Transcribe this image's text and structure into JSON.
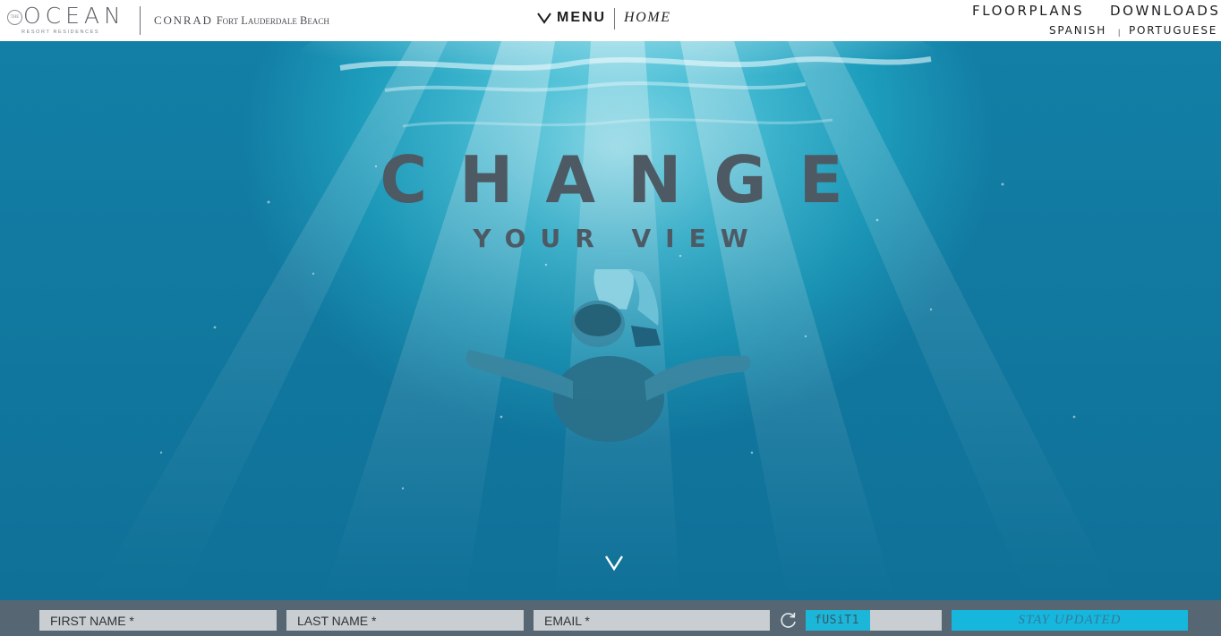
{
  "header": {
    "logo": {
      "small_mark": "THE",
      "word": "OCEAN",
      "tagline": "RESORT RESIDENCES"
    },
    "partner": {
      "brand": "CONRAD",
      "location": "Fort Lauderdale Beach"
    },
    "menu_label": "MENU",
    "home_label": "HOME",
    "nav": {
      "floorplans": "FLOORPLANS",
      "downloads": "DOWNLOADS"
    },
    "languages": {
      "spanish": "SPANISH",
      "separator": "|",
      "portuguese": "PORTUGUESE"
    }
  },
  "hero": {
    "headline": "CHANGE",
    "subhead": "YOUR VIEW",
    "scroll_icon": "chevron-down-icon"
  },
  "signup": {
    "first_name_placeholder": "FIRST NAME *",
    "last_name_placeholder": "LAST NAME *",
    "email_placeholder": "EMAIL *",
    "captcha_code": "fUSiT1",
    "captcha_value": "",
    "submit_label": "STAY UPDATED",
    "refresh_icon": "refresh-icon"
  },
  "colors": {
    "headline": "#4d5a64",
    "signup_bar": "#566672",
    "accent": "#17b7dd",
    "field": "#c8ced2"
  }
}
